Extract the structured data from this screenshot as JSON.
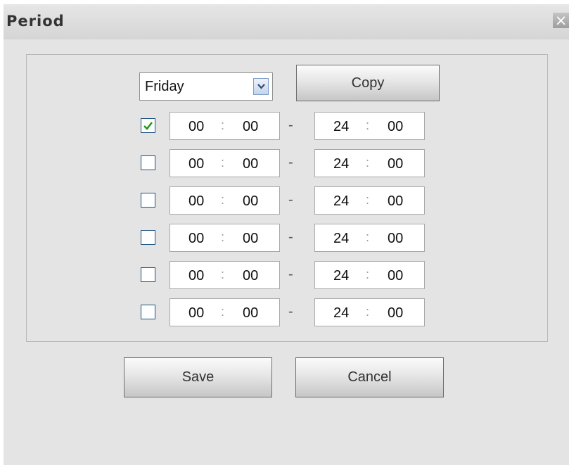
{
  "dialog": {
    "title": "Period",
    "close_icon": "close-icon"
  },
  "day_select": {
    "value": "Friday",
    "arrow_icon": "chevron-down-icon"
  },
  "copy_label": "Copy",
  "separator": "-",
  "time_colon": ":",
  "periods": [
    {
      "checked": true,
      "start_h": "00",
      "start_m": "00",
      "end_h": "24",
      "end_m": "00"
    },
    {
      "checked": false,
      "start_h": "00",
      "start_m": "00",
      "end_h": "24",
      "end_m": "00"
    },
    {
      "checked": false,
      "start_h": "00",
      "start_m": "00",
      "end_h": "24",
      "end_m": "00"
    },
    {
      "checked": false,
      "start_h": "00",
      "start_m": "00",
      "end_h": "24",
      "end_m": "00"
    },
    {
      "checked": false,
      "start_h": "00",
      "start_m": "00",
      "end_h": "24",
      "end_m": "00"
    },
    {
      "checked": false,
      "start_h": "00",
      "start_m": "00",
      "end_h": "24",
      "end_m": "00"
    }
  ],
  "footer": {
    "save_label": "Save",
    "cancel_label": "Cancel"
  },
  "colors": {
    "checkmark": "#1f9a1f",
    "checkbox_border": "#1c5180"
  }
}
